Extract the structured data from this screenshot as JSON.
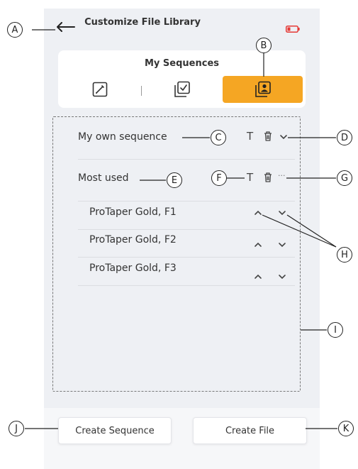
{
  "header": {
    "title": "Customize File Library"
  },
  "card": {
    "title": "My Sequences",
    "tabs": [
      "edit-tab",
      "checklist-tab",
      "library-tab"
    ]
  },
  "list": {
    "sequence_name": "My own sequence",
    "group_name": "Most used",
    "items": [
      "ProTaper Gold, F1",
      "ProTaper Gold, F2",
      "ProTaper Gold, F3"
    ],
    "rename_glyph": "T",
    "more_glyph": "···"
  },
  "buttons": {
    "create_sequence": "Create Sequence",
    "create_file": "Create File"
  },
  "callouts": {
    "a": "A",
    "b": "B",
    "c": "C",
    "d": "D",
    "e": "E",
    "f": "F",
    "g": "G",
    "h": "H",
    "i": "I",
    "j": "J",
    "k": "K"
  },
  "colors": {
    "accent": "#f5a623",
    "screen_bg": "#eef0f4"
  }
}
